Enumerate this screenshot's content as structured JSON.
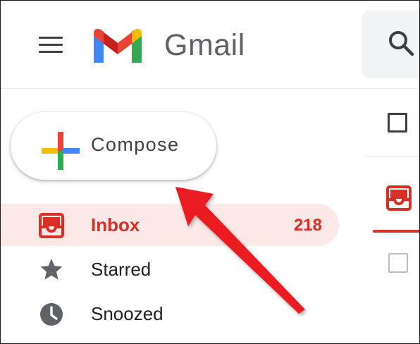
{
  "header": {
    "app_name": "Gmail",
    "menu_icon": "hamburger-menu-icon",
    "logo_icon": "gmail-m-logo",
    "search_icon": "search-icon"
  },
  "compose": {
    "label": "Compose",
    "icon": "plus-icon"
  },
  "sidebar": {
    "items": [
      {
        "label": "Inbox",
        "count": "218",
        "icon": "inbox-icon",
        "active": true
      },
      {
        "label": "Starred",
        "icon": "star-icon",
        "active": false
      },
      {
        "label": "Snoozed",
        "icon": "clock-icon",
        "active": false
      }
    ]
  },
  "annotation": {
    "icon": "red-arrow-pointer",
    "color": "#ea1e24"
  },
  "colors": {
    "active_red": "#d93025",
    "active_bg": "#fce8e6",
    "text_dark": "#202124",
    "icon_gray": "#5f6368",
    "google_blue": "#4285f4",
    "google_red": "#ea4335",
    "google_yellow": "#fbbc04",
    "google_green": "#34a853"
  }
}
